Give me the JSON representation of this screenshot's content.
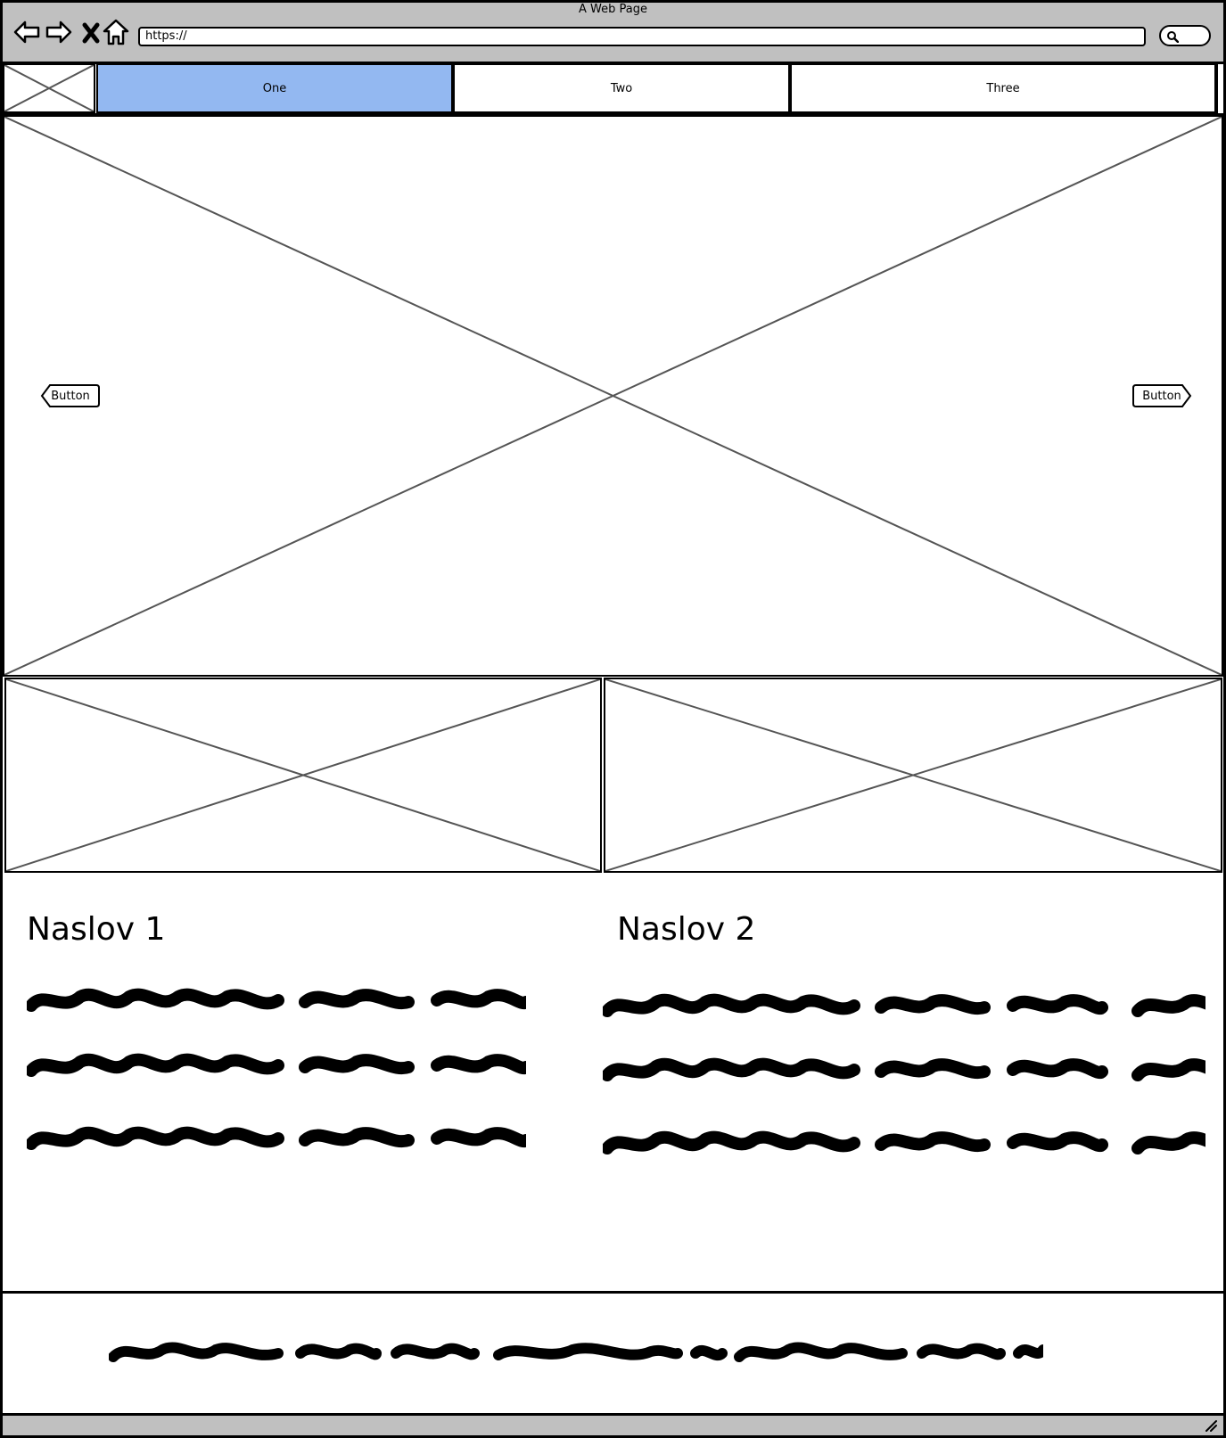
{
  "window": {
    "title": "A Web Page"
  },
  "toolbar": {
    "back_icon": "back-arrow-icon",
    "forward_icon": "forward-arrow-icon",
    "stop_icon": "close-icon",
    "home_icon": "home-icon",
    "address_value": "https://",
    "search_icon": "search-icon"
  },
  "nav": {
    "logo_icon": "image-placeholder-icon",
    "tabs": [
      {
        "label": "One",
        "active": true
      },
      {
        "label": "Two",
        "active": false
      },
      {
        "label": "Three",
        "active": false
      }
    ],
    "active_color": "#93b8f1"
  },
  "hero": {
    "prev_button_label": "Button",
    "next_button_label": "Button"
  },
  "columns": [
    {
      "heading": "Naslov 1"
    },
    {
      "heading": "Naslov 2"
    }
  ],
  "colors": {
    "chrome": "#c0c0c0",
    "placeholder_line": "#555555"
  }
}
